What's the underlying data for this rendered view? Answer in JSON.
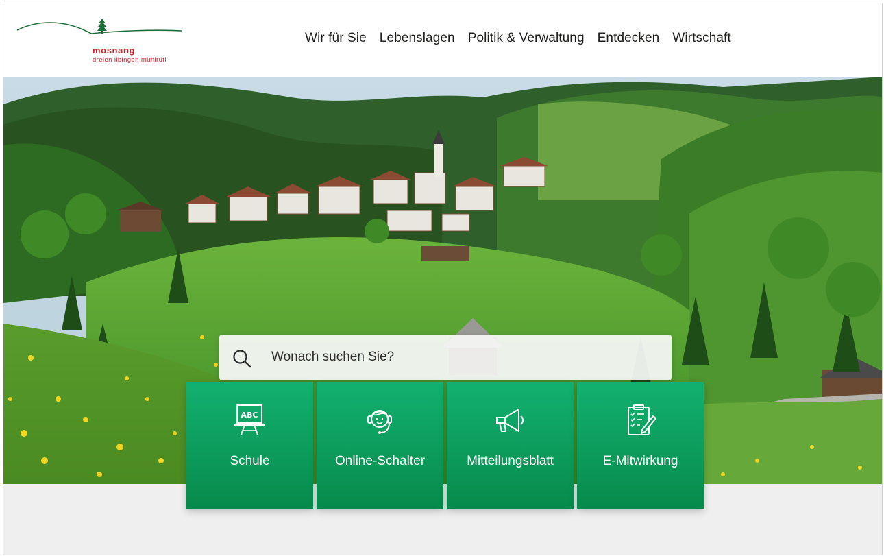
{
  "header": {
    "logo": {
      "name": "mosnang",
      "subtitle": "dreien  libingen  mühlrüti"
    },
    "nav": [
      {
        "label": "Wir für Sie"
      },
      {
        "label": "Lebenslagen"
      },
      {
        "label": "Politik & Verwaltung"
      },
      {
        "label": "Entdecken"
      },
      {
        "label": "Wirtschaft"
      }
    ]
  },
  "search": {
    "placeholder": "Wonach suchen Sie?",
    "icon": "search-icon"
  },
  "tiles": [
    {
      "label": "Schule",
      "icon": "chalkboard-abc-icon"
    },
    {
      "label": "Online-Schalter",
      "icon": "support-agent-headset-icon"
    },
    {
      "label": "Mitteilungsblatt",
      "icon": "megaphone-icon"
    },
    {
      "label": "E-Mitwirkung",
      "icon": "clipboard-checklist-icon"
    }
  ],
  "colors": {
    "brand_red": "#d0232d",
    "brand_green": "#0c9c5c",
    "logo_hill": "#1f6e3a",
    "band_grey": "#efefef"
  }
}
